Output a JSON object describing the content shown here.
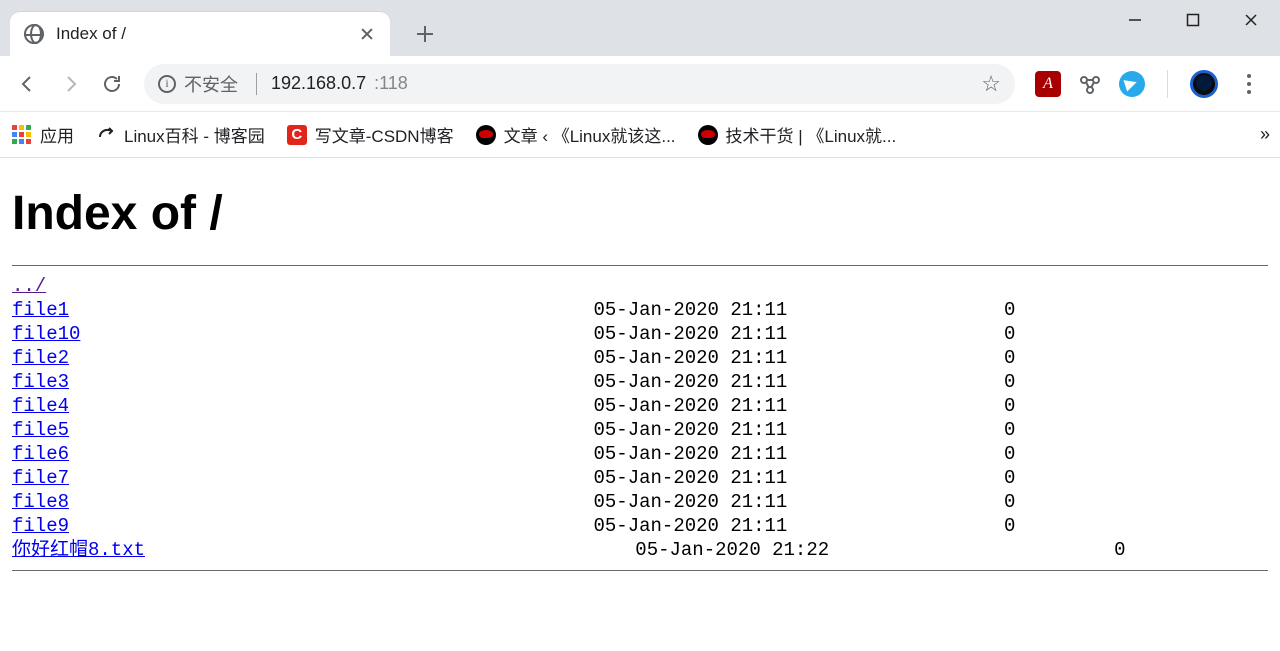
{
  "window": {
    "tab_title": "Index of /"
  },
  "omnibox": {
    "security_label": "不安全",
    "url_host": "192.168.0.7",
    "url_port": ":118"
  },
  "bookmarks": {
    "apps_label": "应用",
    "items": [
      {
        "label": "Linux百科 - 博客园",
        "icon": "cnblogs"
      },
      {
        "label": "写文章-CSDN博客",
        "icon": "csdn"
      },
      {
        "label": "文章 ‹ 《Linux就该这...",
        "icon": "redhat"
      },
      {
        "label": "技术干货 | 《Linux就...",
        "icon": "redhat"
      }
    ]
  },
  "page": {
    "heading": "Index of /",
    "parent_label": "../",
    "files": [
      {
        "name": "file1",
        "date": "05-Jan-2020 21:11",
        "size": "0"
      },
      {
        "name": "file10",
        "date": "05-Jan-2020 21:11",
        "size": "0"
      },
      {
        "name": "file2",
        "date": "05-Jan-2020 21:11",
        "size": "0"
      },
      {
        "name": "file3",
        "date": "05-Jan-2020 21:11",
        "size": "0"
      },
      {
        "name": "file4",
        "date": "05-Jan-2020 21:11",
        "size": "0"
      },
      {
        "name": "file5",
        "date": "05-Jan-2020 21:11",
        "size": "0"
      },
      {
        "name": "file6",
        "date": "05-Jan-2020 21:11",
        "size": "0"
      },
      {
        "name": "file7",
        "date": "05-Jan-2020 21:11",
        "size": "0"
      },
      {
        "name": "file8",
        "date": "05-Jan-2020 21:11",
        "size": "0"
      },
      {
        "name": "file9",
        "date": "05-Jan-2020 21:11",
        "size": "0"
      },
      {
        "name": "你好红帽8.txt",
        "date": "05-Jan-2020 21:22",
        "size": "0",
        "wide": true
      }
    ]
  }
}
